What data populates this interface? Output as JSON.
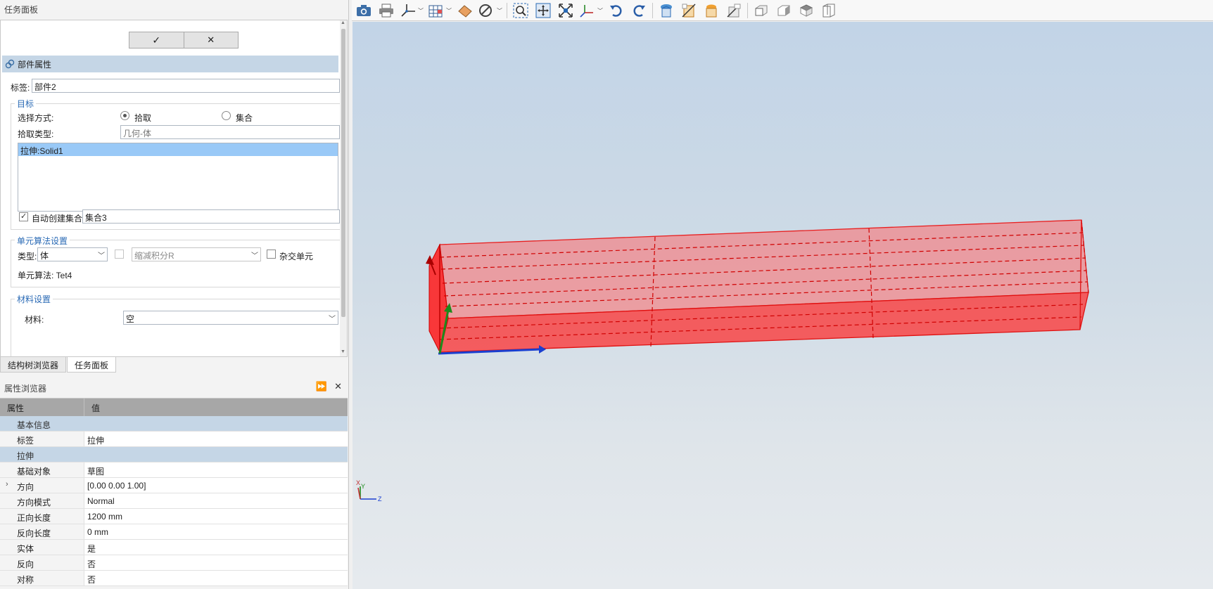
{
  "task_panel": {
    "title": "任务面板",
    "ok_label": "✓",
    "cancel_label": "✕",
    "section_title": "部件属性",
    "label_caption": "标签:",
    "label_value": "部件2",
    "target": {
      "title": "目标",
      "select_mode_caption": "选择方式:",
      "pick_option": "拾取",
      "set_option": "集合",
      "pick_type_caption": "拾取类型:",
      "pick_type_value": "几何-体",
      "list_items": [
        "拉伸:Solid1"
      ],
      "auto_create_label": "自动创建集合",
      "auto_create_value": "集合3"
    },
    "element_settings": {
      "title": "单元算法设置",
      "type_caption": "类型:",
      "type_value": "体",
      "reduced_value": "缩减积分R",
      "hybrid_label": "杂交单元",
      "algorithm_text": "单元算法:  Tet4"
    },
    "material_settings": {
      "title": "材料设置",
      "material_caption": "材料:",
      "material_value": "空"
    }
  },
  "tabs": [
    {
      "label": "结构树浏览器",
      "active": false
    },
    {
      "label": "任务面板",
      "active": true
    }
  ],
  "property_browser": {
    "title": "属性浏览器",
    "col_property": "属性",
    "col_value": "值",
    "groups": [
      {
        "name": "基本信息",
        "rows": [
          {
            "key": "标签",
            "value": "拉伸"
          }
        ]
      },
      {
        "name": "拉伸",
        "rows": [
          {
            "key": "基础对象",
            "value": "草图"
          },
          {
            "key": "方向",
            "value": "[0.00 0.00 1.00]",
            "expandable": true
          },
          {
            "key": "方向模式",
            "value": "Normal"
          },
          {
            "key": "正向长度",
            "value": "1200 mm"
          },
          {
            "key": "反向长度",
            "value": "0 mm"
          },
          {
            "key": "实体",
            "value": "是"
          },
          {
            "key": "反向",
            "value": "否"
          },
          {
            "key": "对称",
            "value": "否"
          }
        ]
      }
    ]
  },
  "toolbar": {
    "icons": [
      "camera-icon",
      "print-icon",
      "axis-view-icon",
      "grid-icon",
      "eraser-icon",
      "no-entry-icon",
      "zoom-box-icon",
      "fit-all-icon",
      "zoom-extents-icon",
      "axis-triad-icon",
      "undo-icon",
      "redo-icon",
      "view-iso-icon",
      "view-section-icon",
      "view-shaded-icon",
      "view-clip-icon",
      "view-front-icon",
      "view-right-icon",
      "view-top-icon",
      "view-box-icon"
    ]
  },
  "viewport": {
    "triad_labels": [
      "X",
      "Y",
      "Z"
    ],
    "solid_color": "#ff2a2a"
  }
}
